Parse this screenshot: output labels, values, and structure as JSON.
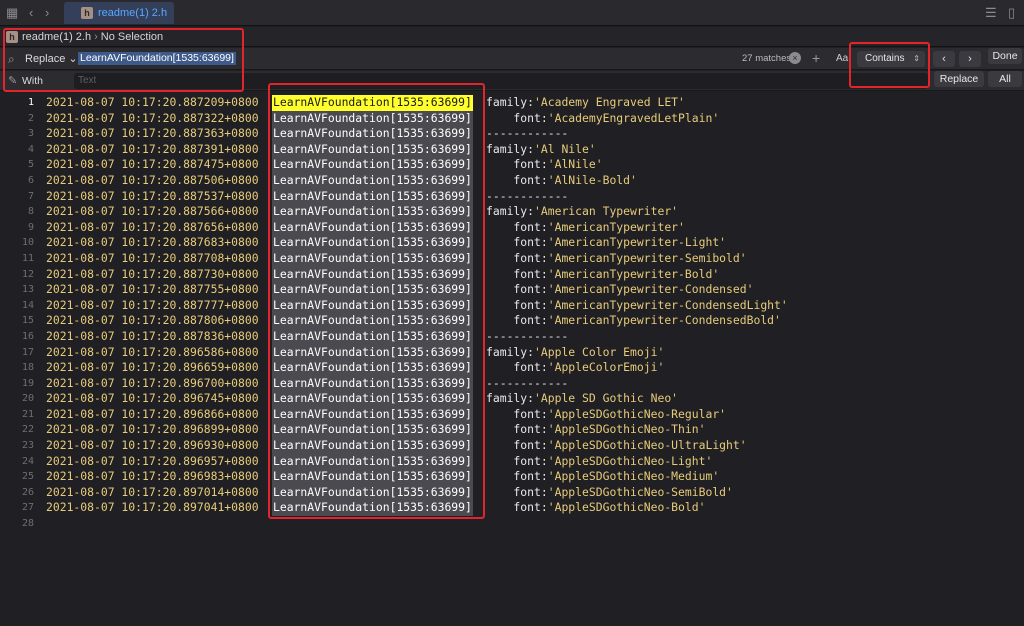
{
  "tabbar": {
    "tab_label": "readme(1) 2.h",
    "file_icon_letter": "h"
  },
  "jumpbar": {
    "file": "readme(1) 2.h",
    "selection": "No Selection"
  },
  "find": {
    "mode": "Replace",
    "query": "LearnAVFoundation[1535:63699]",
    "matches": "27 matches",
    "case_label": "Aa",
    "match_type": "Contains",
    "done_label": "Done",
    "with_label": "With",
    "with_placeholder": "Text",
    "replace_label": "Replace",
    "all_label": "All"
  },
  "editor": {
    "tag": "LearnAVFoundation[1535:63699]",
    "lines": [
      {
        "n": "1",
        "ts": "2021-08-07 10:17:20.887209+0800",
        "kind": "family",
        "value": "'Academy Engraved LET'"
      },
      {
        "n": "2",
        "ts": "2021-08-07 10:17:20.887322+0800",
        "kind": "font",
        "value": "'AcademyEngravedLetPlain'"
      },
      {
        "n": "3",
        "ts": "2021-08-07 10:17:20.887363+0800",
        "kind": "sep",
        "value": "------------"
      },
      {
        "n": "4",
        "ts": "2021-08-07 10:17:20.887391+0800",
        "kind": "family",
        "value": "'Al Nile'"
      },
      {
        "n": "5",
        "ts": "2021-08-07 10:17:20.887475+0800",
        "kind": "font",
        "value": "'AlNile'"
      },
      {
        "n": "6",
        "ts": "2021-08-07 10:17:20.887506+0800",
        "kind": "font",
        "value": "'AlNile-Bold'"
      },
      {
        "n": "7",
        "ts": "2021-08-07 10:17:20.887537+0800",
        "kind": "sep",
        "value": "------------"
      },
      {
        "n": "8",
        "ts": "2021-08-07 10:17:20.887566+0800",
        "kind": "family",
        "value": "'American Typewriter'"
      },
      {
        "n": "9",
        "ts": "2021-08-07 10:17:20.887656+0800",
        "kind": "font",
        "value": "'AmericanTypewriter'"
      },
      {
        "n": "10",
        "ts": "2021-08-07 10:17:20.887683+0800",
        "kind": "font",
        "value": "'AmericanTypewriter-Light'"
      },
      {
        "n": "11",
        "ts": "2021-08-07 10:17:20.887708+0800",
        "kind": "font",
        "value": "'AmericanTypewriter-Semibold'"
      },
      {
        "n": "12",
        "ts": "2021-08-07 10:17:20.887730+0800",
        "kind": "font",
        "value": "'AmericanTypewriter-Bold'"
      },
      {
        "n": "13",
        "ts": "2021-08-07 10:17:20.887755+0800",
        "kind": "font",
        "value": "'AmericanTypewriter-Condensed'"
      },
      {
        "n": "14",
        "ts": "2021-08-07 10:17:20.887777+0800",
        "kind": "font",
        "value": "'AmericanTypewriter-CondensedLight'"
      },
      {
        "n": "15",
        "ts": "2021-08-07 10:17:20.887806+0800",
        "kind": "font",
        "value": "'AmericanTypewriter-CondensedBold'"
      },
      {
        "n": "16",
        "ts": "2021-08-07 10:17:20.887836+0800",
        "kind": "sep",
        "value": "------------"
      },
      {
        "n": "17",
        "ts": "2021-08-07 10:17:20.896586+0800",
        "kind": "family",
        "value": "'Apple Color Emoji'"
      },
      {
        "n": "18",
        "ts": "2021-08-07 10:17:20.896659+0800",
        "kind": "font",
        "value": "'AppleColorEmoji'"
      },
      {
        "n": "19",
        "ts": "2021-08-07 10:17:20.896700+0800",
        "kind": "sep",
        "value": "------------"
      },
      {
        "n": "20",
        "ts": "2021-08-07 10:17:20.896745+0800",
        "kind": "family",
        "value": "'Apple SD Gothic Neo'"
      },
      {
        "n": "21",
        "ts": "2021-08-07 10:17:20.896866+0800",
        "kind": "font",
        "value": "'AppleSDGothicNeo-Regular'"
      },
      {
        "n": "22",
        "ts": "2021-08-07 10:17:20.896899+0800",
        "kind": "font",
        "value": "'AppleSDGothicNeo-Thin'"
      },
      {
        "n": "23",
        "ts": "2021-08-07 10:17:20.896930+0800",
        "kind": "font",
        "value": "'AppleSDGothicNeo-UltraLight'"
      },
      {
        "n": "24",
        "ts": "2021-08-07 10:17:20.896957+0800",
        "kind": "font",
        "value": "'AppleSDGothicNeo-Light'"
      },
      {
        "n": "25",
        "ts": "2021-08-07 10:17:20.896983+0800",
        "kind": "font",
        "value": "'AppleSDGothicNeo-Medium'"
      },
      {
        "n": "26",
        "ts": "2021-08-07 10:17:20.897014+0800",
        "kind": "font",
        "value": "'AppleSDGothicNeo-SemiBold'"
      },
      {
        "n": "27",
        "ts": "2021-08-07 10:17:20.897041+0800",
        "kind": "font",
        "value": "'AppleSDGothicNeo-Bold'"
      },
      {
        "n": "28",
        "ts": "",
        "kind": "empty",
        "value": ""
      }
    ]
  },
  "colors": {
    "highlight_active": "#ffff2e",
    "highlight_match": "#4a4a50",
    "timestamp": "#e7cc7a",
    "tab_text": "#5aa7ff",
    "annotation": "#e3242b"
  }
}
